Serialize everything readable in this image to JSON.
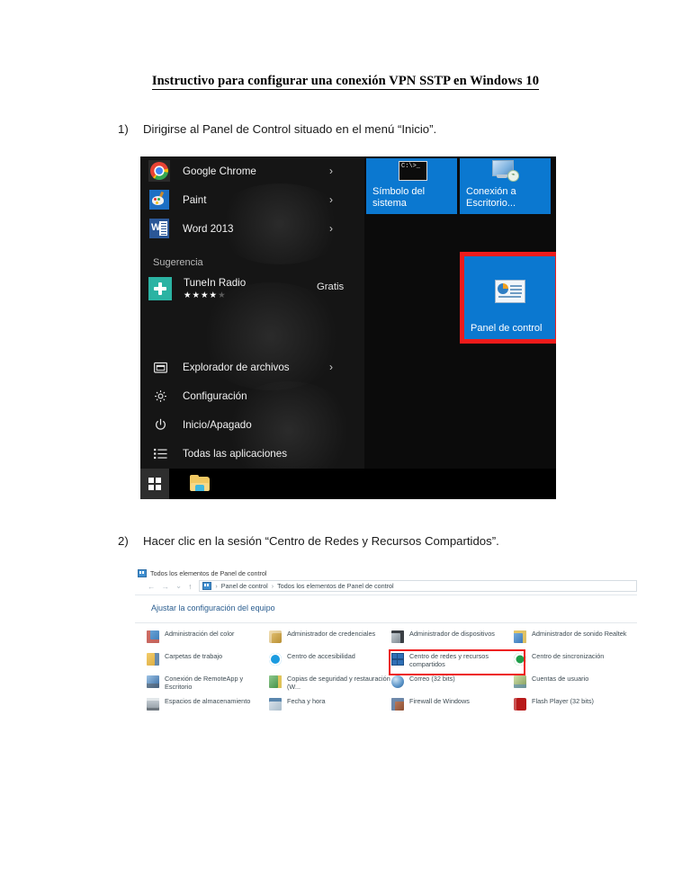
{
  "document": {
    "title": "Instructivo para configurar una conexión VPN SSTP en Windows 10",
    "steps": [
      {
        "marker": "1)",
        "text": "Dirigirse al Panel de Control situado en el menú “Inicio”."
      },
      {
        "marker": "2)",
        "text": "Hacer clic en la sesión “Centro de Redes y Recursos Compartidos”."
      }
    ]
  },
  "colors": {
    "highlight_red": "#ee1b1b",
    "tile_blue": "#0b78d0",
    "heading_blue": "#2a5d8f",
    "item_text_green": "#3c4a52"
  },
  "start_menu": {
    "apps": [
      {
        "label": "Google Chrome",
        "icon": "chrome-icon",
        "chevron": "›"
      },
      {
        "label": "Paint",
        "icon": "paint-icon",
        "chevron": "›"
      },
      {
        "label": "Word 2013",
        "icon": "word-icon",
        "chevron": "›"
      }
    ],
    "suggestion": {
      "header": "Sugerencia",
      "name": "TuneIn Radio",
      "price": "Gratis",
      "icon": "tunein-icon",
      "stars_filled": "★★★★",
      "stars_empty": "★"
    },
    "system_items": [
      {
        "label": "Explorador de archivos",
        "icon": "file-explorer-icon",
        "chevron": "›"
      },
      {
        "label": "Configuración",
        "icon": "gear-icon",
        "chevron": ""
      },
      {
        "label": "Inicio/Apagado",
        "icon": "power-icon",
        "chevron": ""
      },
      {
        "label": "Todas las aplicaciones",
        "icon": "list-icon",
        "chevron": ""
      }
    ],
    "tiles": [
      {
        "label": "Símbolo del sistema",
        "icon": "command-prompt-icon",
        "highlighted": false
      },
      {
        "label": "Conexión a Escritorio...",
        "icon": "remote-desktop-icon",
        "highlighted": false
      },
      {
        "label": "Panel de control",
        "icon": "control-panel-icon",
        "highlighted": true
      }
    ],
    "taskbar": {
      "start_icon": "windows-logo-icon",
      "folder_icon": "file-explorer-folder-icon"
    }
  },
  "control_panel": {
    "window_title": "Todos los elementos de Panel de control",
    "nav": {
      "back": "←",
      "forward": "→",
      "recent": "⌄",
      "up": "↑"
    },
    "breadcrumb": {
      "root": "Panel de control",
      "separator": "›",
      "current": "Todos los elementos de Panel de control"
    },
    "heading": "Ajustar la configuración del equipo",
    "columns": [
      {
        "items": [
          {
            "label": "Administración del color",
            "icon": "color-management-icon",
            "highlighted": false
          },
          {
            "label": "Carpetas de trabajo",
            "icon": "work-folders-icon",
            "highlighted": false
          },
          {
            "label": "Conexión de RemoteApp y Escritorio",
            "icon": "remoteapp-icon",
            "highlighted": false
          },
          {
            "label": "Espacios de almacenamiento",
            "icon": "storage-spaces-icon",
            "highlighted": false
          }
        ]
      },
      {
        "items": [
          {
            "label": "Administrador de credenciales",
            "icon": "credential-manager-icon",
            "highlighted": false
          },
          {
            "label": "Centro de accesibilidad",
            "icon": "ease-of-access-icon",
            "highlighted": false
          },
          {
            "label": "Copias de seguridad y restauración (W...",
            "icon": "backup-restore-icon",
            "highlighted": false
          },
          {
            "label": "Fecha y hora",
            "icon": "date-time-icon",
            "highlighted": false
          }
        ]
      },
      {
        "items": [
          {
            "label": "Administrador de dispositivos",
            "icon": "device-manager-icon",
            "highlighted": false
          },
          {
            "label": "Centro de redes y recursos compartidos",
            "icon": "network-sharing-center-icon",
            "highlighted": true
          },
          {
            "label": "Correo (32 bits)",
            "icon": "mail-icon",
            "highlighted": false
          },
          {
            "label": "Firewall de Windows",
            "icon": "firewall-icon",
            "highlighted": false
          }
        ]
      },
      {
        "items": [
          {
            "label": "Administrador de sonido Realtek",
            "icon": "realtek-audio-icon",
            "highlighted": false
          },
          {
            "label": "Centro de sincronización",
            "icon": "sync-center-icon",
            "highlighted": false
          },
          {
            "label": "Cuentas de usuario",
            "icon": "user-accounts-icon",
            "highlighted": false
          },
          {
            "label": "Flash Player (32 bits)",
            "icon": "flash-player-icon",
            "highlighted": false
          }
        ]
      }
    ]
  }
}
